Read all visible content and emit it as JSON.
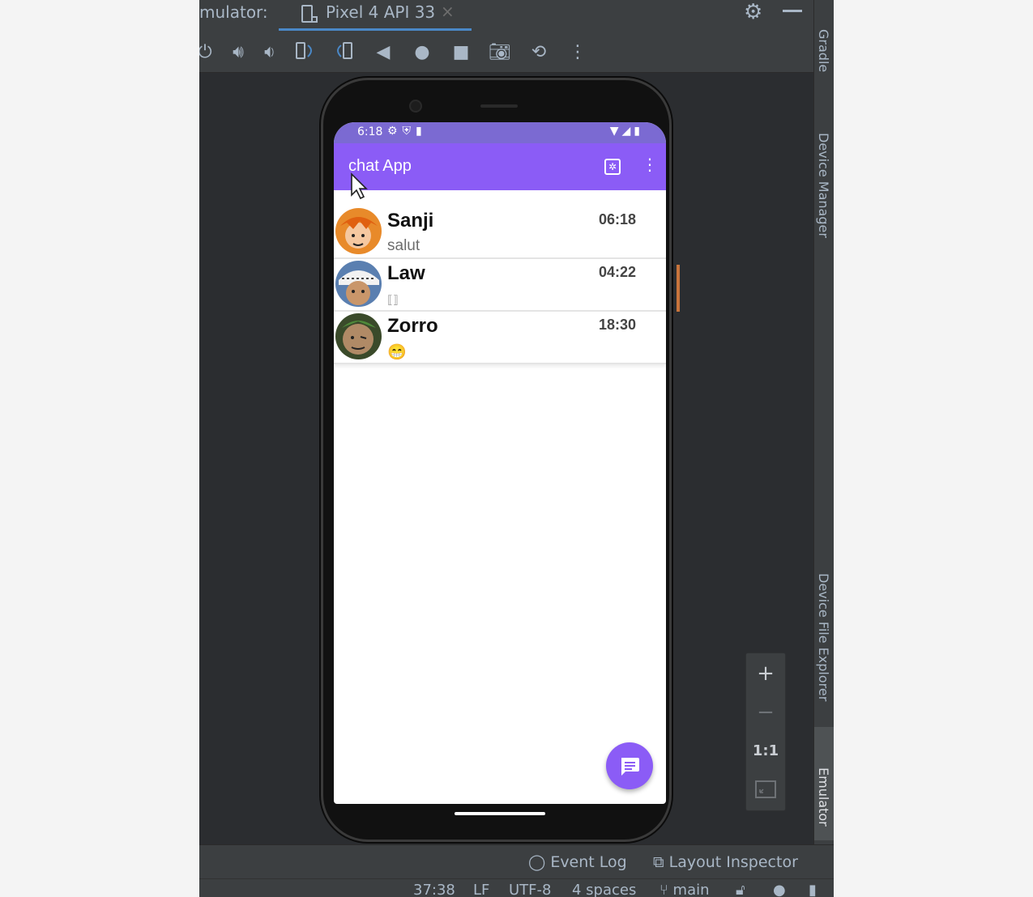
{
  "window": {
    "title_prefix": "mulator:",
    "tab_label": "Pixel 4 API 33",
    "tab_close": "×"
  },
  "sidebar_right": {
    "items": [
      {
        "label": "Gradle"
      },
      {
        "label": "Device Manager"
      },
      {
        "label": "Device File Explorer"
      },
      {
        "label": "Emulator"
      }
    ]
  },
  "zoom": {
    "plus": "+",
    "minus": "−",
    "one_to_one": "1:1"
  },
  "device": {
    "status": {
      "time": "6:18"
    },
    "app": {
      "title": "chat App"
    },
    "chats": [
      {
        "name": "Sanji",
        "message": "salut",
        "time": "06:18"
      },
      {
        "name": "Law",
        "message": "⟦⟧",
        "time": "04:22"
      },
      {
        "name": "Zorro",
        "message": "😁",
        "time": "18:30"
      }
    ]
  },
  "bottom": {
    "event_log": "Event Log",
    "layout_inspector": "Layout Inspector"
  },
  "statusline": {
    "position": "37:38",
    "line_ending": "LF",
    "encoding": "UTF-8",
    "indent": "4 spaces",
    "branch": "main"
  },
  "colors": {
    "app_bar": "#8b5cf6",
    "status_bar": "#7b6ad2",
    "ide_bg": "#2b2d30",
    "ide_panel": "#3c3f41",
    "tab_underline": "#4a88c7"
  }
}
